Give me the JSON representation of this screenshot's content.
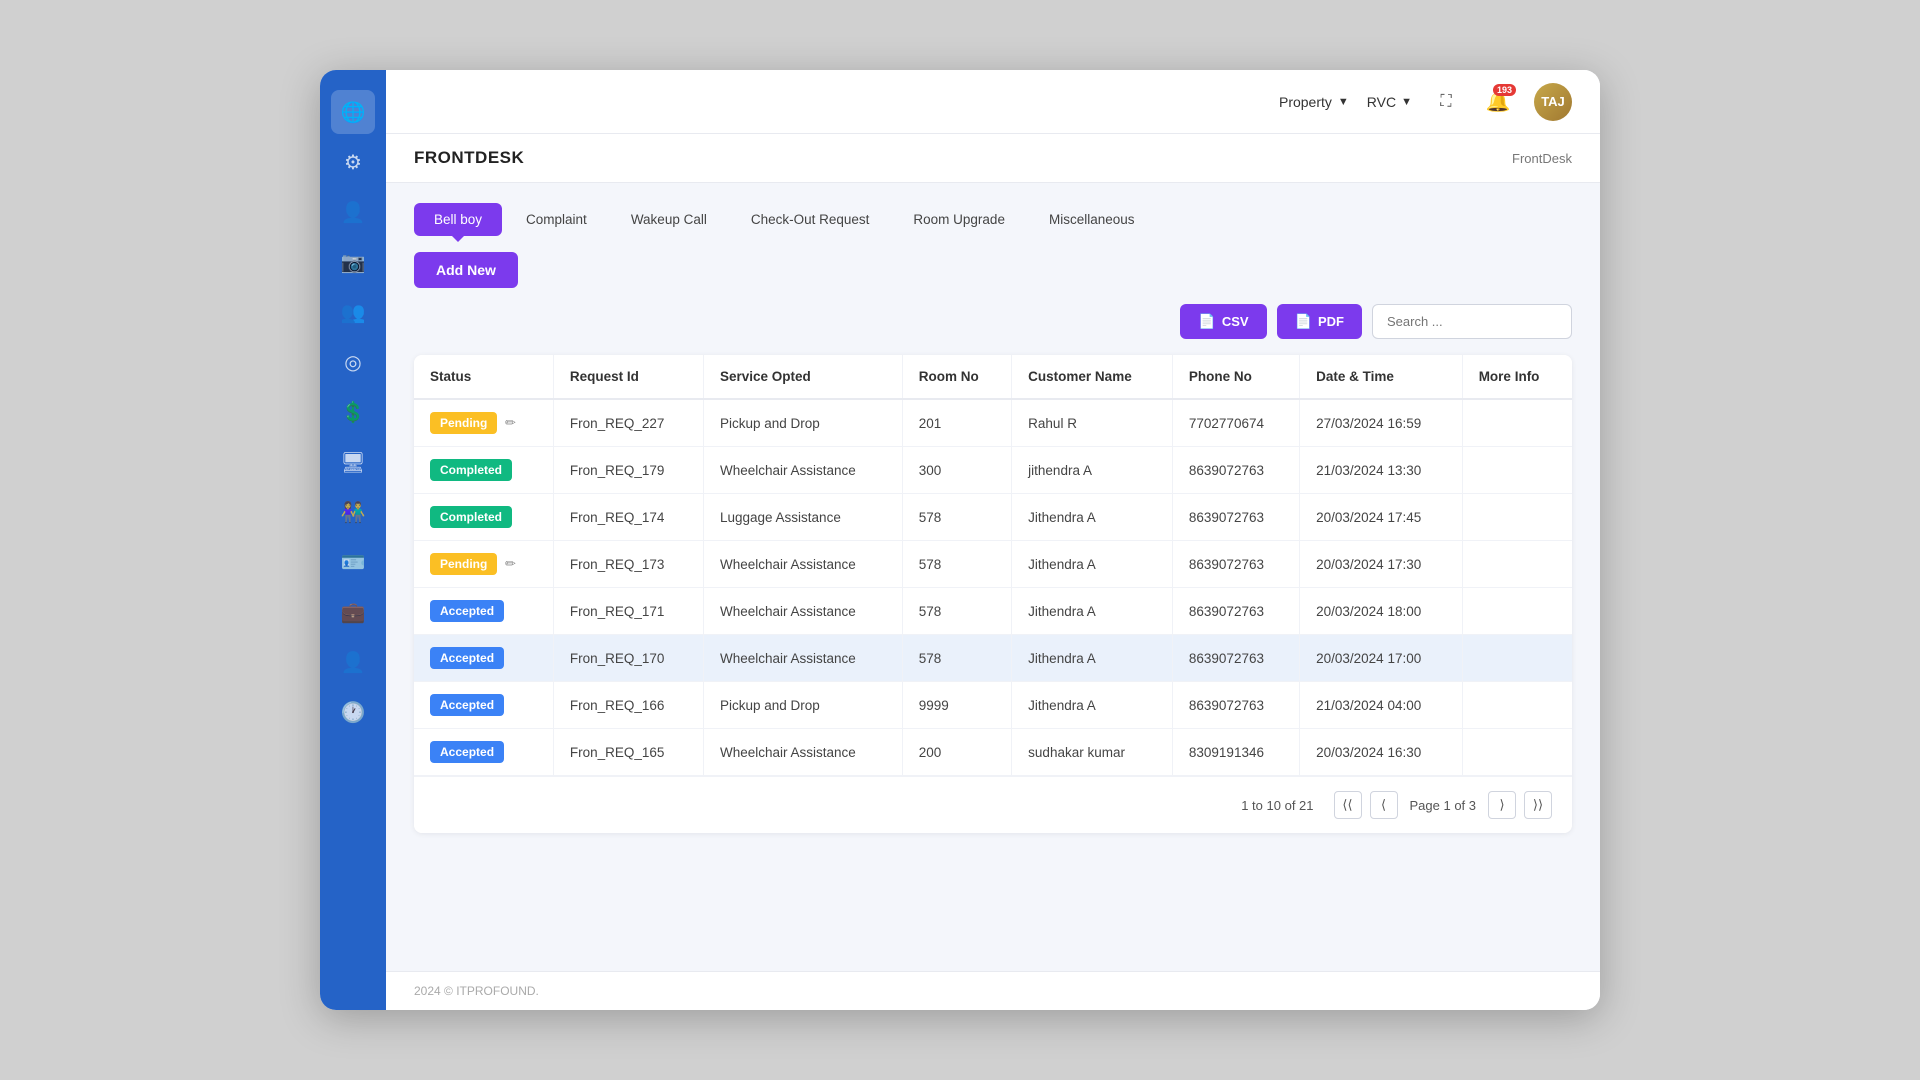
{
  "topbar": {
    "property_label": "Property",
    "rvc_label": "RVC",
    "notification_count": "193",
    "avatar_initials": "TAJ"
  },
  "page_header": {
    "title": "FRONTDESK",
    "breadcrumb": "FrontDesk"
  },
  "tabs": [
    {
      "id": "bellboy",
      "label": "Bell boy",
      "active": true
    },
    {
      "id": "complaint",
      "label": "Complaint",
      "active": false
    },
    {
      "id": "wakeupcall",
      "label": "Wakeup Call",
      "active": false
    },
    {
      "id": "checkoutrequest",
      "label": "Check-Out Request",
      "active": false
    },
    {
      "id": "roomupgrade",
      "label": "Room Upgrade",
      "active": false
    },
    {
      "id": "miscellaneous",
      "label": "Miscellaneous",
      "active": false
    }
  ],
  "add_new_label": "Add New",
  "toolbar": {
    "csv_label": "CSV",
    "pdf_label": "PDF",
    "search_placeholder": "Search ..."
  },
  "table": {
    "columns": [
      "Status",
      "Request Id",
      "Service Opted",
      "Room No",
      "Customer Name",
      "Phone No",
      "Date & Time",
      "More Info"
    ],
    "rows": [
      {
        "status": "Pending",
        "status_type": "pending",
        "editable": true,
        "request_id": "Fron_REQ_227",
        "service": "Pickup and Drop",
        "room_no": "201",
        "customer": "Rahul R",
        "phone": "7702770674",
        "datetime": "27/03/2024 16:59",
        "more_info": "",
        "highlighted": false
      },
      {
        "status": "Completed",
        "status_type": "completed",
        "editable": false,
        "request_id": "Fron_REQ_179",
        "service": "Wheelchair Assistance",
        "room_no": "300",
        "customer": "jithendra A",
        "phone": "8639072763",
        "datetime": "21/03/2024 13:30",
        "more_info": "",
        "highlighted": false
      },
      {
        "status": "Completed",
        "status_type": "completed",
        "editable": false,
        "request_id": "Fron_REQ_174",
        "service": "Luggage Assistance",
        "room_no": "578",
        "customer": "Jithendra A",
        "phone": "8639072763",
        "datetime": "20/03/2024 17:45",
        "more_info": "",
        "highlighted": false
      },
      {
        "status": "Pending",
        "status_type": "pending",
        "editable": true,
        "request_id": "Fron_REQ_173",
        "service": "Wheelchair Assistance",
        "room_no": "578",
        "customer": "Jithendra A",
        "phone": "8639072763",
        "datetime": "20/03/2024 17:30",
        "more_info": "",
        "highlighted": false
      },
      {
        "status": "Accepted",
        "status_type": "accepted",
        "editable": false,
        "request_id": "Fron_REQ_171",
        "service": "Wheelchair Assistance",
        "room_no": "578",
        "customer": "Jithendra A",
        "phone": "8639072763",
        "datetime": "20/03/2024 18:00",
        "more_info": "",
        "highlighted": false
      },
      {
        "status": "Accepted",
        "status_type": "accepted",
        "editable": false,
        "request_id": "Fron_REQ_170",
        "service": "Wheelchair Assistance",
        "room_no": "578",
        "customer": "Jithendra A",
        "phone": "8639072763",
        "datetime": "20/03/2024 17:00",
        "more_info": "",
        "highlighted": true
      },
      {
        "status": "Accepted",
        "status_type": "accepted",
        "editable": false,
        "request_id": "Fron_REQ_166",
        "service": "Pickup and Drop",
        "room_no": "9999",
        "customer": "Jithendra A",
        "phone": "8639072763",
        "datetime": "21/03/2024 04:00",
        "more_info": "",
        "highlighted": false
      },
      {
        "status": "Accepted",
        "status_type": "accepted",
        "editable": false,
        "request_id": "Fron_REQ_165",
        "service": "Wheelchair Assistance",
        "room_no": "200",
        "customer": "sudhakar kumar",
        "phone": "8309191346",
        "datetime": "20/03/2024 16:30",
        "more_info": "",
        "highlighted": false
      }
    ]
  },
  "pagination": {
    "range_start": "1",
    "range_end": "10",
    "total": "21",
    "current_page": "1",
    "total_pages": "3",
    "page_label": "Page 1 of 3"
  },
  "footer": {
    "text": "2024 © ITPROFOUND."
  },
  "sidebar_icons": [
    {
      "name": "globe-icon",
      "symbol": "🌐",
      "active": true
    },
    {
      "name": "settings-icon",
      "symbol": "⚙",
      "active": false
    },
    {
      "name": "user-icon",
      "symbol": "👤",
      "active": false
    },
    {
      "name": "camera-icon",
      "symbol": "📷",
      "active": false
    },
    {
      "name": "add-user-icon",
      "symbol": "👥",
      "active": false
    },
    {
      "name": "circle-icon",
      "symbol": "◎",
      "active": false
    },
    {
      "name": "dollar-icon",
      "symbol": "💲",
      "active": false
    },
    {
      "name": "monitor-icon",
      "symbol": "🖥",
      "active": false
    },
    {
      "name": "people-icon",
      "symbol": "👫",
      "active": false
    },
    {
      "name": "card-icon",
      "symbol": "🪪",
      "active": false
    },
    {
      "name": "briefcase-icon",
      "symbol": "💼",
      "active": false
    },
    {
      "name": "profile-icon",
      "symbol": "👤",
      "active": false
    },
    {
      "name": "clock-icon",
      "symbol": "🕐",
      "active": false
    }
  ]
}
